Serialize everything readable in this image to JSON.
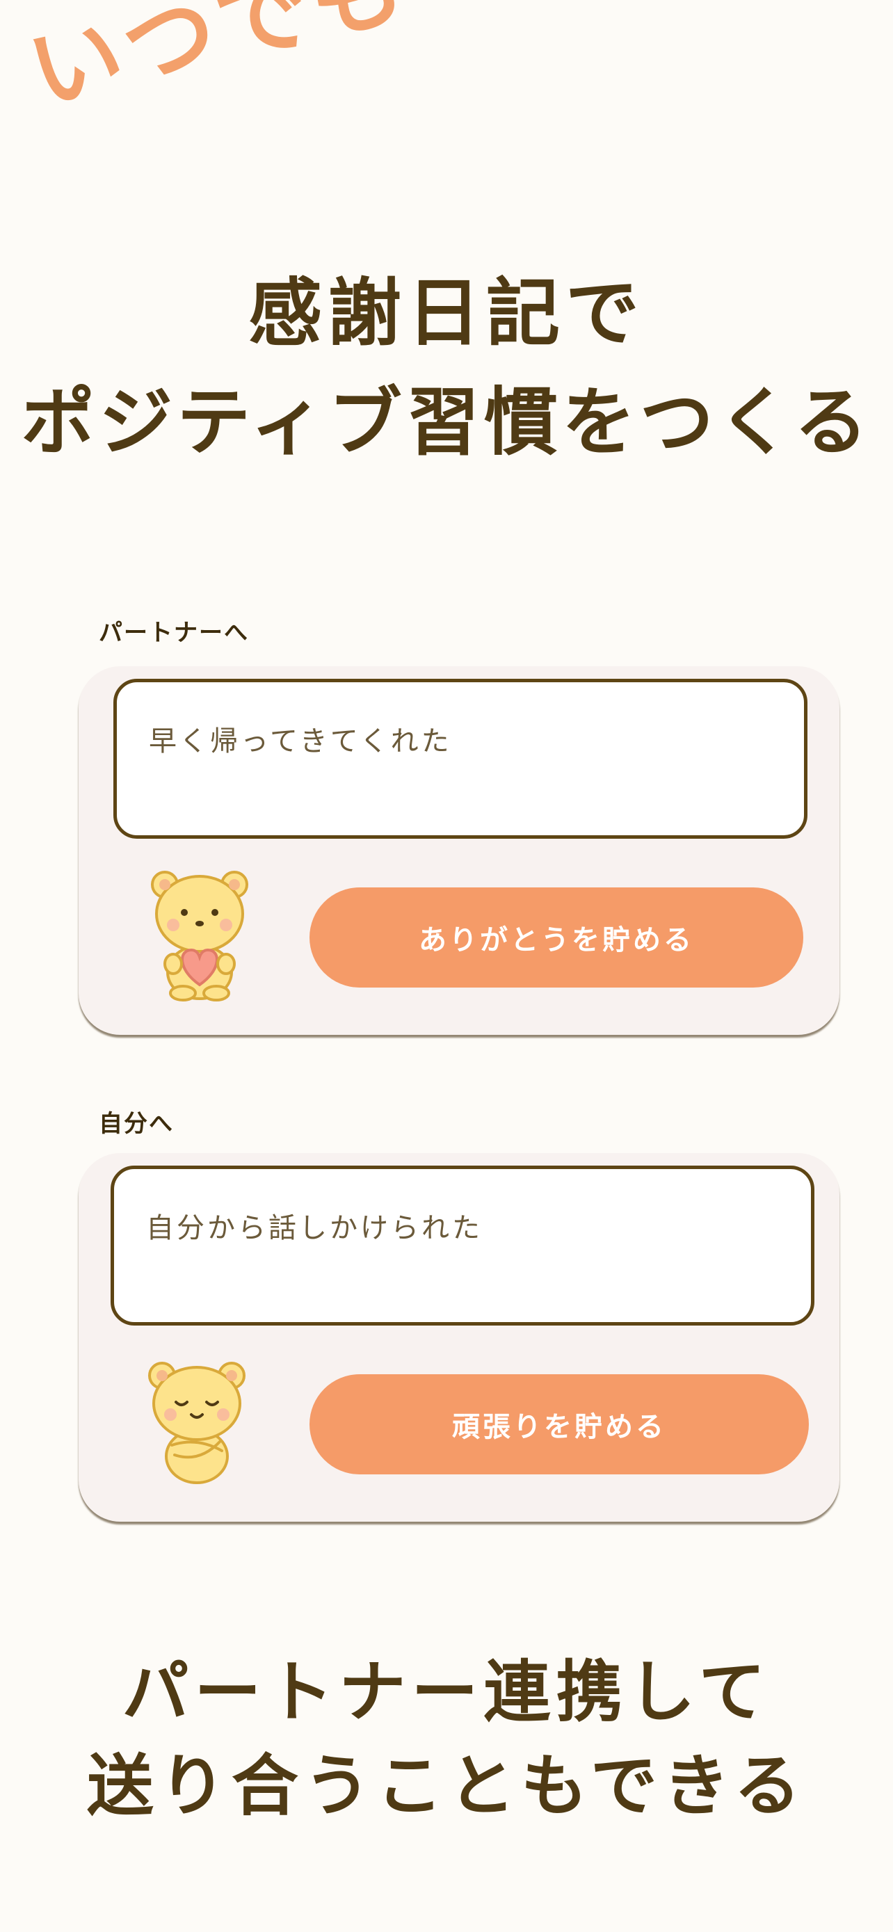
{
  "tagline": "いつでも",
  "headline": {
    "line1": "感謝日記で",
    "line2": "ポジティブ習慣をつくる"
  },
  "partner_section": {
    "label": "パートナーへ",
    "entry_text": "早く帰ってきてくれた",
    "button_label": "ありがとうを貯める",
    "mascot_icon": "bear-holding-heart-icon"
  },
  "self_section": {
    "label": "自分へ",
    "entry_text": "自分から話しかけられた",
    "button_label": "頑張りを貯める",
    "mascot_icon": "bear-self-hug-icon"
  },
  "footer": {
    "line1": "パートナー連携して",
    "line2": "送り合うこともできる"
  },
  "colors": {
    "background": "#fdfbf7",
    "accent_orange": "#f59b68",
    "heading_brown": "#4f3a14",
    "card_background": "#f8f2f0",
    "bear_yellow": "#fde38c"
  }
}
